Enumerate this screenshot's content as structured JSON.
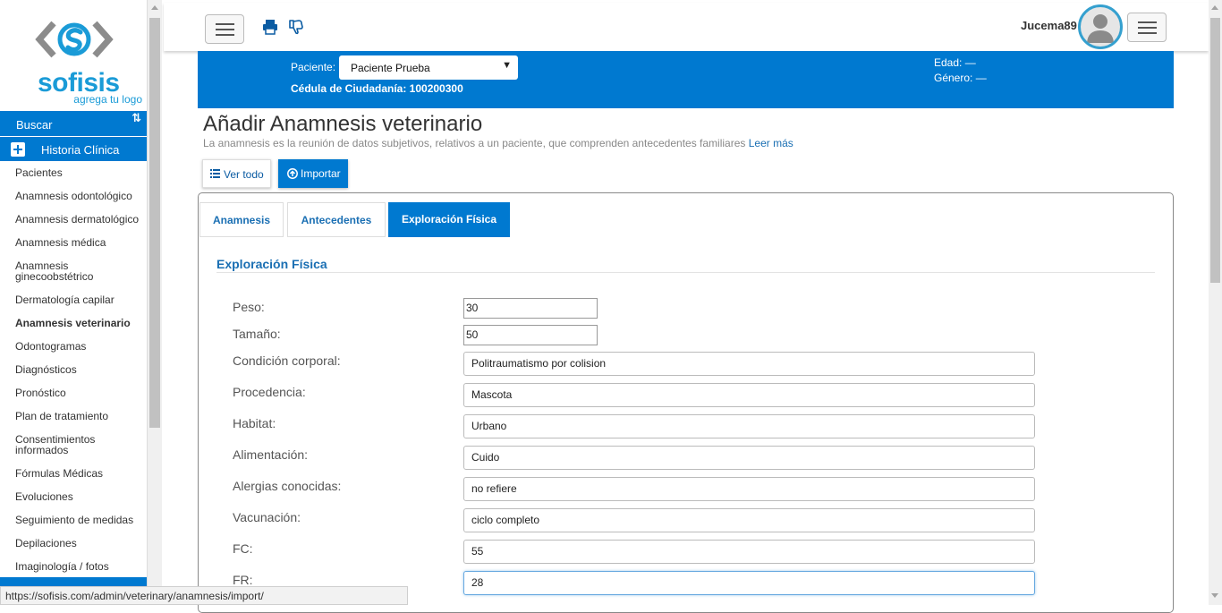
{
  "logo": {
    "brand": "sofisis",
    "tagline": "agrega tu logo"
  },
  "sidebar": {
    "search_label": "Buscar",
    "section_label": "Historia Clínica",
    "items": [
      {
        "label": "Pacientes"
      },
      {
        "label": "Anamnesis odontológico"
      },
      {
        "label": "Anamnesis dermatológico"
      },
      {
        "label": "Anamnesis médica"
      },
      {
        "label": "Anamnesis ginecoobstétrico"
      },
      {
        "label": "Dermatología capilar"
      },
      {
        "label": "Anamnesis veterinario",
        "active": true
      },
      {
        "label": "Odontogramas"
      },
      {
        "label": "Diagnósticos"
      },
      {
        "label": "Pronóstico"
      },
      {
        "label": "Plan de tratamiento"
      },
      {
        "label": "Consentimientos informados"
      },
      {
        "label": "Fórmulas Médicas"
      },
      {
        "label": "Evoluciones"
      },
      {
        "label": "Seguimiento de medidas"
      },
      {
        "label": "Depilaciones"
      },
      {
        "label": "Imaginología / fotos"
      }
    ]
  },
  "header": {
    "username": "Jucema89"
  },
  "patient": {
    "label": "Paciente:",
    "selected": "Paciente Prueba",
    "cedula": "Cédula de Ciudadanía: 100200300",
    "edad": "Edad: —",
    "genero": "Género: —"
  },
  "page": {
    "title": "Añadir Anamnesis veterinario",
    "subtitle": "La anamnesis es la reunión de datos subjetivos, relativos a un paciente, que comprenden antecedentes familiares",
    "read_more": "Leer más",
    "btn_ver_todo": "Ver todo",
    "btn_importar": "Importar"
  },
  "tabs": [
    {
      "label": "Anamnesis"
    },
    {
      "label": "Antecedentes"
    },
    {
      "label": "Exploración Física",
      "active": true
    }
  ],
  "section_title": "Exploración Física",
  "fields": [
    {
      "label": "Peso:",
      "value": "30"
    },
    {
      "label": "Tamaño:",
      "value": "50"
    },
    {
      "label": "Condición corporal:",
      "value": "Politraumatismo por colision"
    },
    {
      "label": "Procedencia:",
      "value": "Mascota"
    },
    {
      "label": "Habitat:",
      "value": "Urbano"
    },
    {
      "label": "Alimentación:",
      "value": "Cuido"
    },
    {
      "label": "Alergias conocidas:",
      "value": "no refiere"
    },
    {
      "label": "Vacunación:",
      "value": "ciclo completo"
    },
    {
      "label": "FC:",
      "value": "55"
    },
    {
      "label": "FR:",
      "value": "28"
    }
  ],
  "statusbar": {
    "url": "https://sofisis.com/admin/veterinary/anamnesis/import/"
  },
  "colors": {
    "primary": "#0079d0",
    "link": "#1a6fb3",
    "brand": "#1a9bd7"
  }
}
